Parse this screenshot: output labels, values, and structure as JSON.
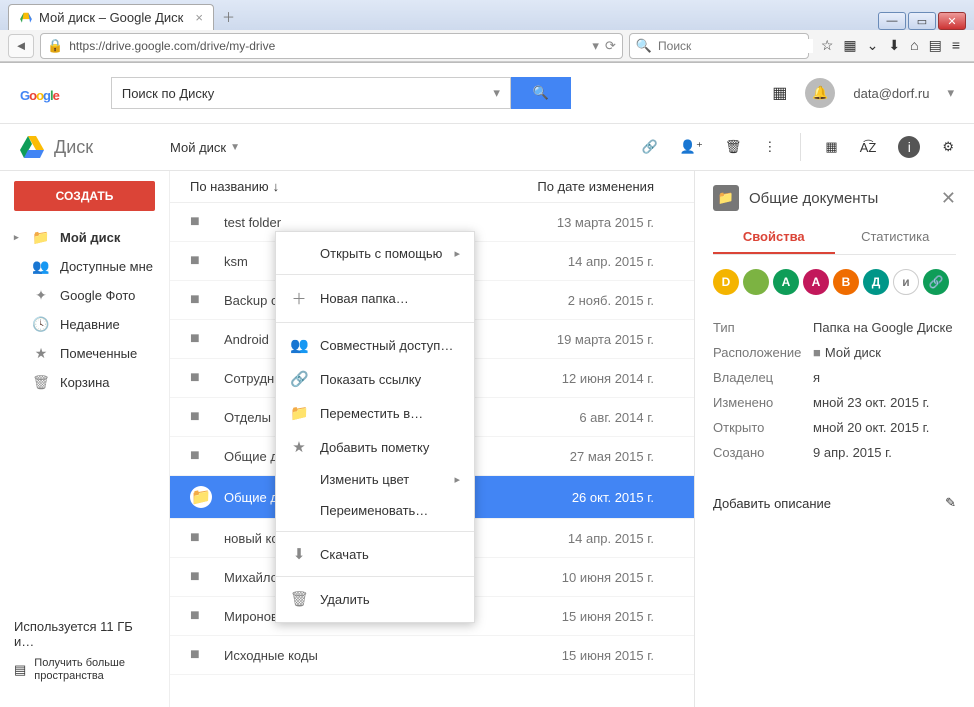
{
  "browser": {
    "tab_title": "Мой диск – Google Диск",
    "url": "https://drive.google.com/drive/my-drive",
    "search_placeholder": "Поиск"
  },
  "header": {
    "search_placeholder": "Поиск по Диску",
    "email": "data@dorf.ru"
  },
  "brand": {
    "name": "Диск"
  },
  "breadcrumb": {
    "label": "Мой диск"
  },
  "sidebar": {
    "create": "СОЗДАТЬ",
    "items": [
      {
        "label": "Мой диск",
        "active": true
      },
      {
        "label": "Доступные мне"
      },
      {
        "label": "Google Фото"
      },
      {
        "label": "Недавние"
      },
      {
        "label": "Помеченные"
      },
      {
        "label": "Корзина"
      }
    ],
    "storage": "Используется 11 ГБ и…",
    "more_label": "Получить больше пространства"
  },
  "columns": {
    "name": "По названию",
    "modified": "По дате изменения"
  },
  "files": [
    {
      "name": "test folder",
      "date": "13 марта 2015 г."
    },
    {
      "name": "ksm",
      "date": "14 апр. 2015 г."
    },
    {
      "name": "Backup сай",
      "date": "2 нояб. 2015 г."
    },
    {
      "name": "Android",
      "date": "19 марта 2015 г."
    },
    {
      "name": "Сотрудники",
      "date": "12 июня 2014 г."
    },
    {
      "name": "Отделы",
      "date": "6 авг. 2014 г."
    },
    {
      "name": "Общие док",
      "date": "27 мая 2015 г."
    },
    {
      "name": "Общие документы",
      "date": "26 окт. 2015 г.",
      "selected": true
    },
    {
      "name": "новый ксм",
      "date": "14 апр. 2015 г."
    },
    {
      "name": "Михайлов",
      "date": "10 июня 2015 г."
    },
    {
      "name": "Миронов",
      "date": "15 июня 2015 г."
    },
    {
      "name": "Исходные коды",
      "date": "15 июня 2015 г."
    }
  ],
  "context_menu": [
    {
      "label": "Открыть с помощью",
      "icon": "",
      "sub": true
    },
    {
      "sep": true
    },
    {
      "label": "Новая папка…",
      "icon": "＋"
    },
    {
      "sep": true
    },
    {
      "label": "Совместный доступ…",
      "icon": "👥"
    },
    {
      "label": "Показать ссылку",
      "icon": "🔗"
    },
    {
      "label": "Переместить в…",
      "icon": "📁"
    },
    {
      "label": "Добавить пометку",
      "icon": "★"
    },
    {
      "label": "Изменить цвет",
      "icon": "",
      "sub": true
    },
    {
      "label": "Переименовать…",
      "icon": ""
    },
    {
      "sep": true
    },
    {
      "label": "Скачать",
      "icon": "⬇"
    },
    {
      "sep": true
    },
    {
      "label": "Удалить",
      "icon": "🗑"
    }
  ],
  "details": {
    "title": "Общие документы",
    "tabs": {
      "props": "Свойства",
      "stats": "Статистика"
    },
    "avatars": [
      {
        "t": "D",
        "c": "#f4b400"
      },
      {
        "t": "",
        "c": "#7cb342",
        "img": true
      },
      {
        "t": "А",
        "c": "#0f9d58"
      },
      {
        "t": "А",
        "c": "#c2185b"
      },
      {
        "t": "В",
        "c": "#ef6c00"
      },
      {
        "t": "Д",
        "c": "#009688"
      },
      {
        "t": "и",
        "c": "#fff",
        "fg": "#777",
        "border": true
      },
      {
        "t": "🔗",
        "c": "#0f9d58"
      }
    ],
    "props": [
      {
        "k": "Тип",
        "v": "Папка на Google Диске"
      },
      {
        "k": "Расположение",
        "v": "Мой диск",
        "folder": true
      },
      {
        "k": "Владелец",
        "v": "я"
      },
      {
        "k": "Изменено",
        "v": "мной 23 окт. 2015 г."
      },
      {
        "k": "Открыто",
        "v": "мной 20 окт. 2015 г."
      },
      {
        "k": "Создано",
        "v": "9 апр. 2015 г."
      }
    ],
    "add_desc": "Добавить описание"
  }
}
